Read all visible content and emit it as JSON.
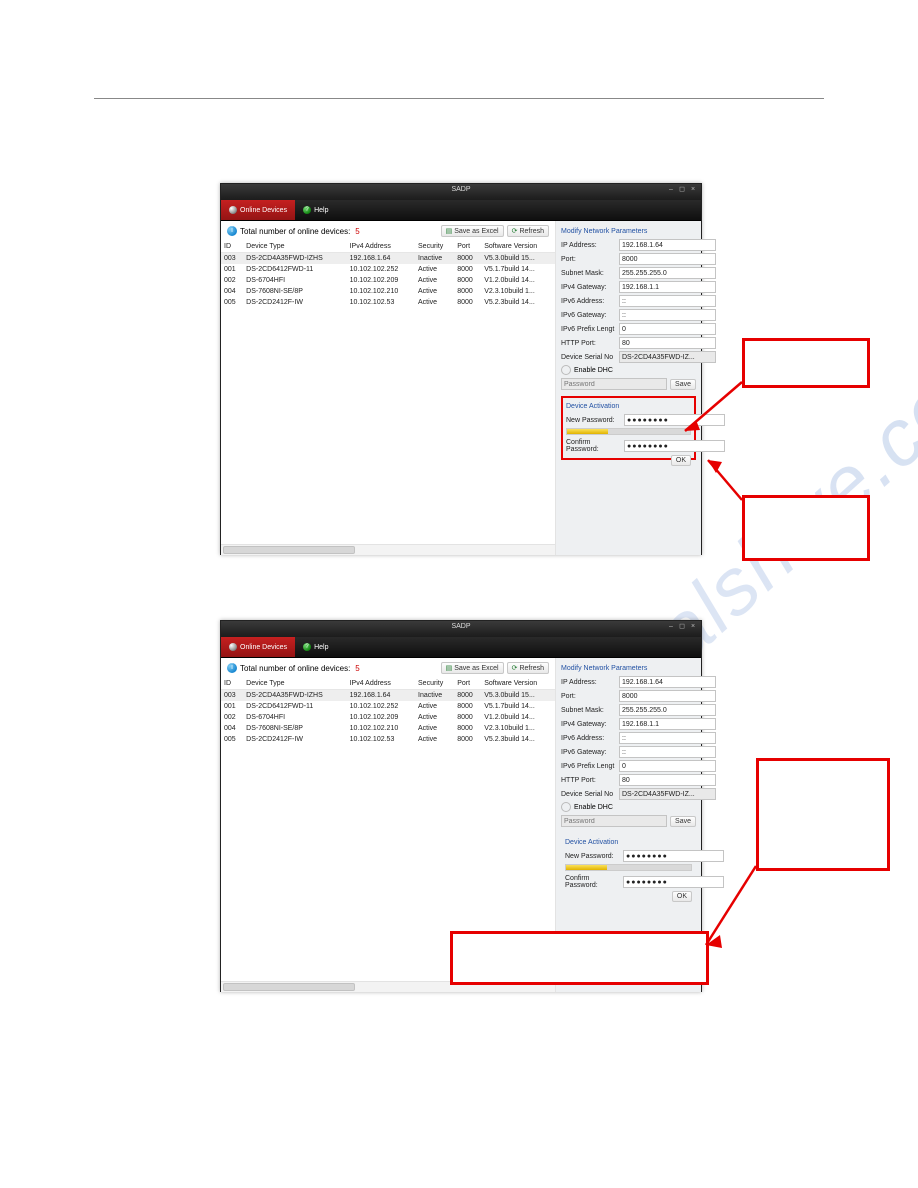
{
  "app_title": "SADP",
  "tabs": {
    "online": "Online Devices",
    "help": "Help"
  },
  "countbar": {
    "label": "Total number of online devices:",
    "count": "5",
    "save_excel": "Save as Excel",
    "refresh": "Refresh"
  },
  "columns": {
    "id": "ID",
    "type": "Device Type",
    "ip": "IPv4 Address",
    "sec": "Security",
    "port": "Port",
    "sw": "Software Version"
  },
  "rows": [
    {
      "id": "003",
      "type": "DS-2CD4A35FWD-IZHS",
      "ip": "192.168.1.64",
      "sec": "Inactive",
      "port": "8000",
      "sw": "V5.3.0build 15..."
    },
    {
      "id": "001",
      "type": "DS-2CD6412FWD-11",
      "ip": "10.102.102.252",
      "sec": "Active",
      "port": "8000",
      "sw": "V5.1.7build 14..."
    },
    {
      "id": "002",
      "type": "DS-6704HFI",
      "ip": "10.102.102.209",
      "sec": "Active",
      "port": "8000",
      "sw": "V1.2.0build 14..."
    },
    {
      "id": "004",
      "type": "DS-7608NI-SE/8P",
      "ip": "10.102.102.210",
      "sec": "Active",
      "port": "8000",
      "sw": "V2.3.10build 1..."
    },
    {
      "id": "005",
      "type": "DS-2CD2412F-IW",
      "ip": "10.102.102.53",
      "sec": "Active",
      "port": "8000",
      "sw": "V5.2.3build 14..."
    }
  ],
  "panel": {
    "title": "Modify Network Parameters",
    "ip_label": "IP Address:",
    "ip": "192.168.1.64",
    "port_label": "Port:",
    "port": "8000",
    "mask_label": "Subnet Mask:",
    "mask": "255.255.255.0",
    "gw_label": "IPv4 Gateway:",
    "gw": "192.168.1.1",
    "ip6_label": "IPv6 Address:",
    "ip6": "::",
    "gw6_label": "IPv6 Gateway:",
    "gw6": "::",
    "pfx_label": "IPv6 Prefix Lengt",
    "pfx": "0",
    "http_label": "HTTP Port:",
    "http": "80",
    "serial_label": "Device Serial No",
    "serial": "DS-2CD4A35FWD-IZ...",
    "dhcp": "Enable DHC",
    "password_ph": "Password",
    "save": "Save"
  },
  "activation": {
    "title": "Device Activation",
    "new_label": "New Password:",
    "confirm_label": "Confirm Password:",
    "dots": "●●●●●●●●",
    "ok": "OK"
  }
}
